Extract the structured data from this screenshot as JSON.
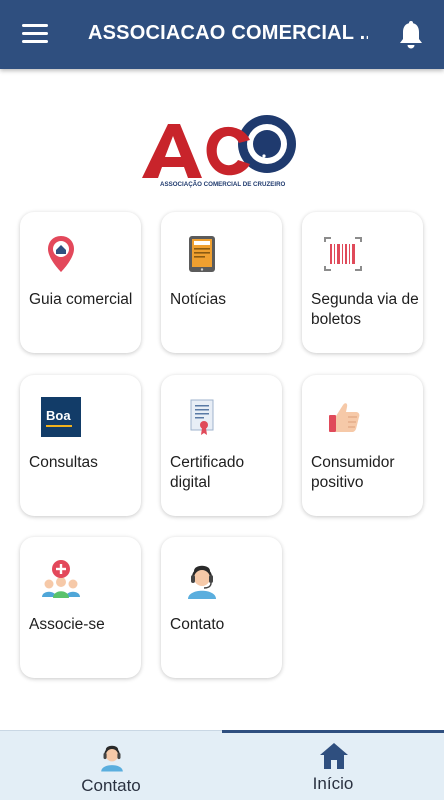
{
  "header": {
    "title": "ASSOCIACAO COMERCIAL ...",
    "menu_icon": "hamburger-menu-icon",
    "notification_icon": "bell-icon",
    "background": "#2f4f7f"
  },
  "logo": {
    "text": "ACC",
    "subtitle": "ASSOCIAÇÃO COMERCIAL DE CRUZEIRO",
    "colors": {
      "red": "#c8242b",
      "blue": "#1f3a6e"
    }
  },
  "menu_cards": [
    {
      "label": "Guia comercial",
      "icon": "map-pin-icon"
    },
    {
      "label": "Notícias",
      "icon": "news-tablet-icon"
    },
    {
      "label": "Segunda via de boletos",
      "icon": "barcode-icon"
    },
    {
      "label": "Consultas",
      "icon": "boa-vista-logo-icon"
    },
    {
      "label": "Certificado digital",
      "icon": "certificate-icon"
    },
    {
      "label": "Consumidor positivo",
      "icon": "thumbs-up-icon"
    },
    {
      "label": "Associe-se",
      "icon": "group-add-icon"
    },
    {
      "label": "Contato",
      "icon": "headset-agent-icon"
    }
  ],
  "bottom_nav": {
    "items": [
      {
        "label": "Contato",
        "icon": "headset-agent-icon",
        "active": false
      },
      {
        "label": "Início",
        "icon": "home-icon",
        "active": true
      }
    ]
  }
}
